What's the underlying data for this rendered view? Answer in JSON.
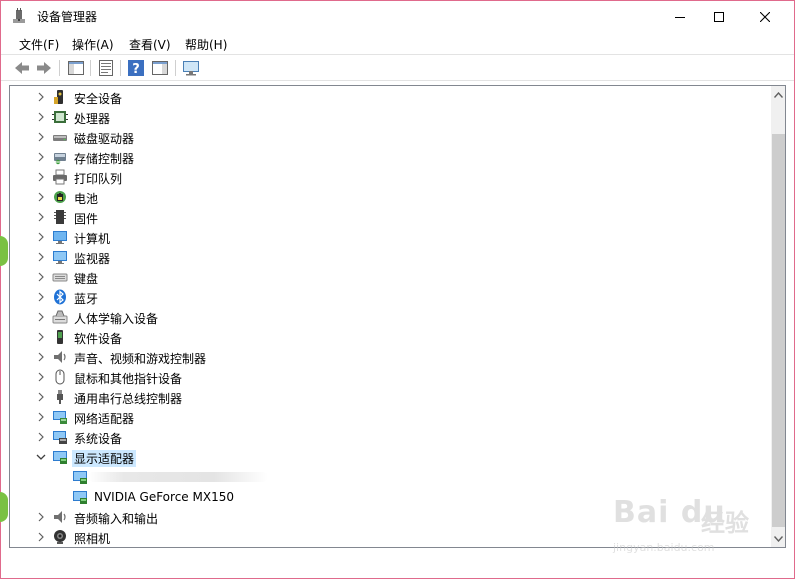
{
  "window": {
    "title": "设备管理器"
  },
  "menu": [
    {
      "label": "文件(F)"
    },
    {
      "label": "操作(A)"
    },
    {
      "label": "查看(V)"
    },
    {
      "label": "帮助(H)"
    }
  ],
  "toolbar": {
    "icons": [
      "back-arrow-icon",
      "forward-arrow-icon",
      "show-hide-console-tree-icon",
      "properties-icon",
      "help-icon",
      "action-pane-icon",
      "scan-hardware-icon"
    ]
  },
  "tree": {
    "items": [
      {
        "label": "安全设备",
        "icon": "security-device-icon",
        "expanded": false
      },
      {
        "label": "处理器",
        "icon": "processor-icon",
        "expanded": false
      },
      {
        "label": "磁盘驱动器",
        "icon": "disk-drive-icon",
        "expanded": false
      },
      {
        "label": "存储控制器",
        "icon": "storage-controller-icon",
        "expanded": false
      },
      {
        "label": "打印队列",
        "icon": "printer-icon",
        "expanded": false
      },
      {
        "label": "电池",
        "icon": "battery-icon",
        "expanded": false
      },
      {
        "label": "固件",
        "icon": "firmware-icon",
        "expanded": false
      },
      {
        "label": "计算机",
        "icon": "computer-icon",
        "expanded": false
      },
      {
        "label": "监视器",
        "icon": "monitor-icon",
        "expanded": false
      },
      {
        "label": "键盘",
        "icon": "keyboard-icon",
        "expanded": false
      },
      {
        "label": "蓝牙",
        "icon": "bluetooth-icon",
        "expanded": false
      },
      {
        "label": "人体学输入设备",
        "icon": "hid-icon",
        "expanded": false
      },
      {
        "label": "软件设备",
        "icon": "software-device-icon",
        "expanded": false
      },
      {
        "label": "声音、视频和游戏控制器",
        "icon": "speaker-icon",
        "expanded": false
      },
      {
        "label": "鼠标和其他指针设备",
        "icon": "mouse-icon",
        "expanded": false
      },
      {
        "label": "通用串行总线控制器",
        "icon": "usb-icon",
        "expanded": false
      },
      {
        "label": "网络适配器",
        "icon": "network-adapter-icon",
        "expanded": false
      },
      {
        "label": "系统设备",
        "icon": "system-device-icon",
        "expanded": false
      },
      {
        "label": "显示适配器",
        "icon": "display-adapter-icon",
        "expanded": true
      },
      {
        "label": "NVIDIA GeForce MX150",
        "icon": "display-adapter-icon",
        "child": true
      },
      {
        "label": "音频输入和输出",
        "icon": "audio-io-icon",
        "expanded": false
      },
      {
        "label": "照相机",
        "icon": "camera-icon",
        "expanded": false
      }
    ]
  },
  "watermark": {
    "logo": "Bai du",
    "jy": "经验",
    "site": "jingyan.baidu.com"
  }
}
